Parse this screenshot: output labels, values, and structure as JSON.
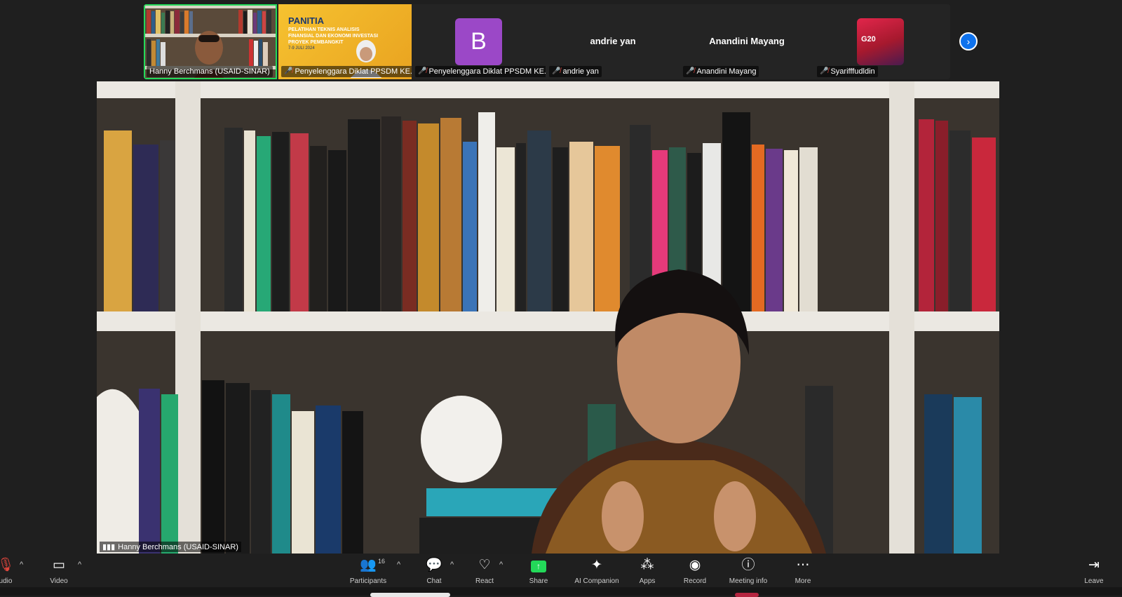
{
  "gallery": {
    "tiles": [
      {
        "name": "Hanny Berchmans (USAID-SINAR)",
        "muted": false,
        "kind": "video",
        "active": true
      },
      {
        "name": "Penyelenggara Diklat PPSDM KE...",
        "muted": true,
        "kind": "banner",
        "banner_title": "PANITIA",
        "banner_text": "PELATIHAN TEKNIS ANALISIS FINANSIAL DAN EKONOMI INVESTASI PROYEK PEMBANGKIT",
        "banner_date": "7-9 JULI 2024"
      },
      {
        "name": "Penyelenggara Diklat PPSDM KE...",
        "muted": true,
        "kind": "avatar",
        "avatar_letter": "B",
        "avatar_color": "#9b48c7"
      },
      {
        "name": "andrie yan",
        "muted": true,
        "kind": "name",
        "display_name": "andrie yan"
      },
      {
        "name": "Anandini Mayang",
        "muted": true,
        "kind": "name",
        "display_name": "Anandini Mayang"
      },
      {
        "name": "Syarifffudldin",
        "muted": true,
        "kind": "logo",
        "logo_text": "G20"
      }
    ],
    "next_icon": "chevron-right-icon"
  },
  "main_video": {
    "speaker_name": "Hanny Berchmans (USAID-SINAR)",
    "signal_icon": "signal-bars-icon"
  },
  "toolbar": {
    "audio_label": "udio",
    "video_label": "Video",
    "participants_label": "Participants",
    "participants_count": "16",
    "chat_label": "Chat",
    "react_label": "React",
    "share_label": "Share",
    "ai_label": "AI Companion",
    "apps_label": "Apps",
    "record_label": "Record",
    "info_label": "Meeting info",
    "more_label": "More",
    "leave_label": "Leave"
  },
  "colors": {
    "accent_green": "#23d959",
    "accent_blue": "#0e72ed",
    "mute_red": "#e0453c"
  }
}
